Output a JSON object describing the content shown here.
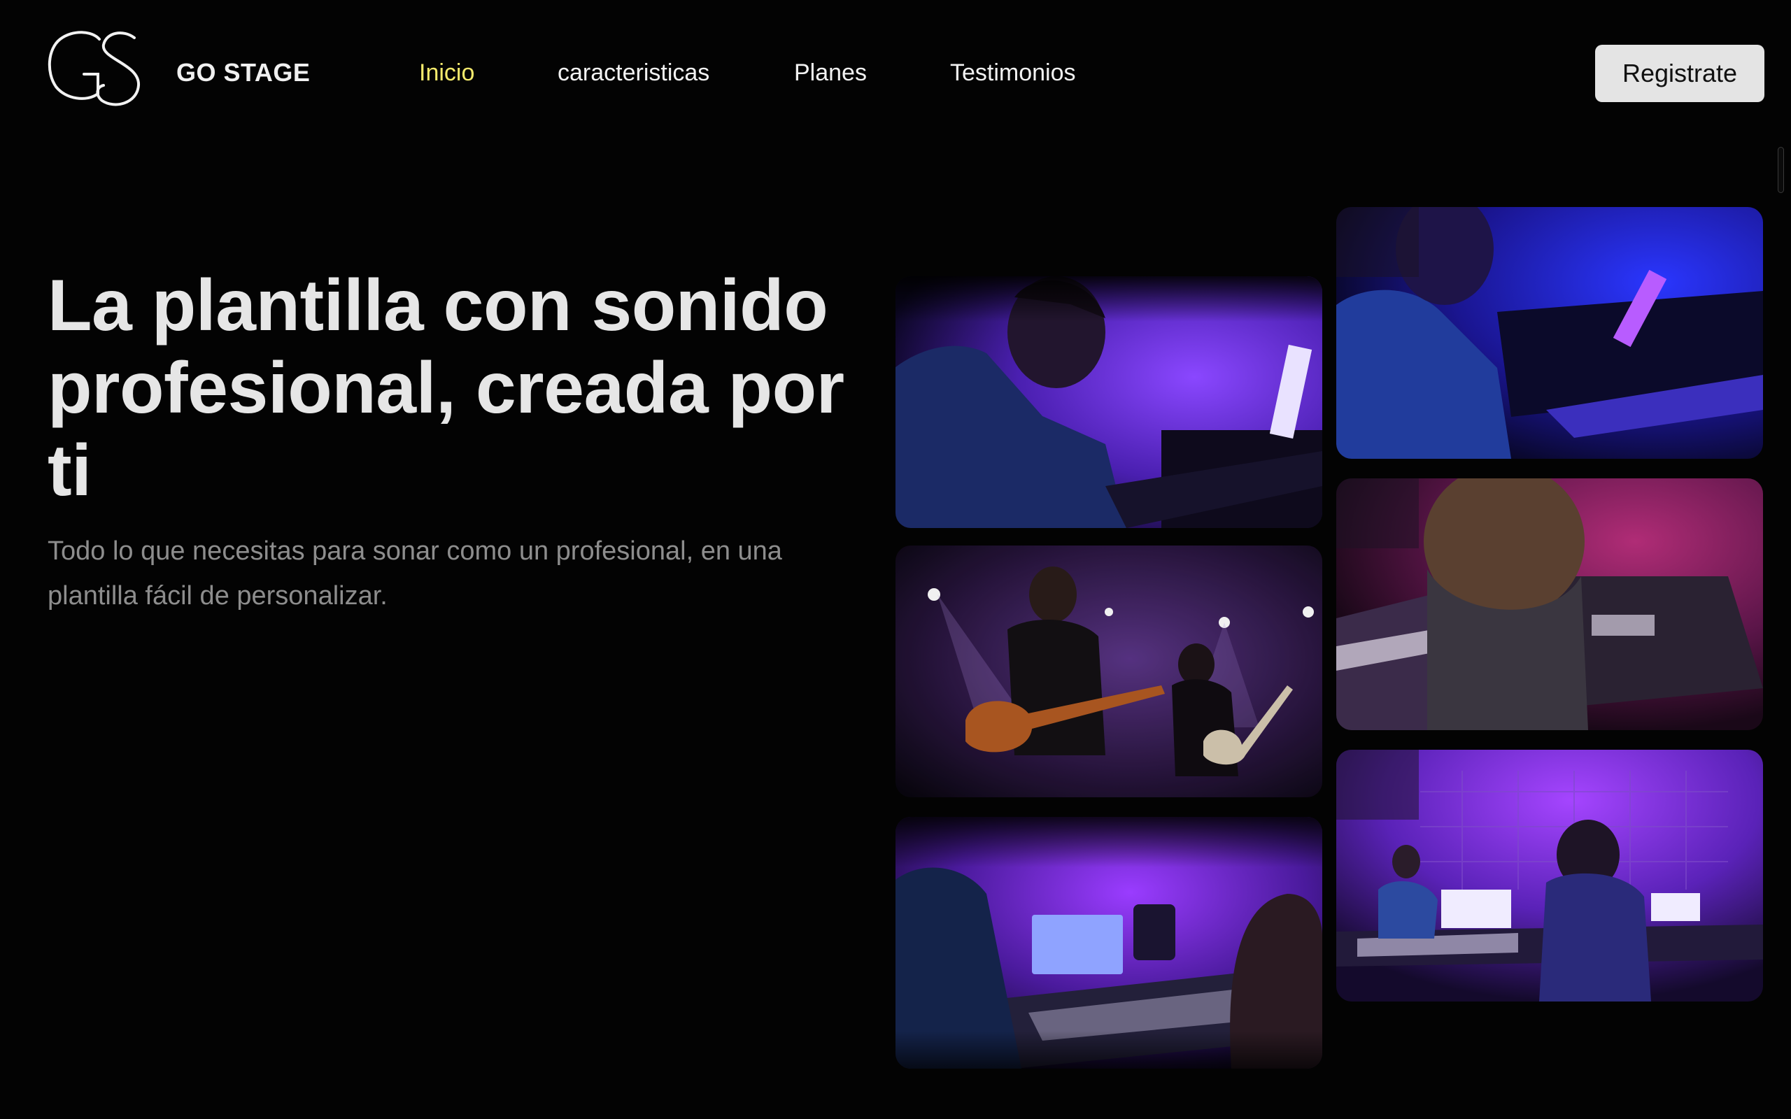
{
  "brand": {
    "logo_letters": "GS",
    "name": "GO STAGE"
  },
  "nav": {
    "items": [
      {
        "label": "Inicio",
        "active": true
      },
      {
        "label": "caracteristicas",
        "active": false
      },
      {
        "label": "Planes",
        "active": false
      },
      {
        "label": "Testimonios",
        "active": false
      }
    ]
  },
  "cta": {
    "register_label": "Registrate"
  },
  "hero": {
    "title": "La plantilla con sonido profesional, creada por ti",
    "subtitle": "Todo lo que necesitas para sonar como un profesional, en una plantilla fácil de personalizar."
  },
  "gallery": {
    "photos": [
      {
        "subject": "musician-at-keyboard-purple-light"
      },
      {
        "subject": "pianist-blue-light"
      },
      {
        "subject": "guitarists-on-stage"
      },
      {
        "subject": "synthesizer-over-shoulder"
      },
      {
        "subject": "producers-at-mixing-console"
      },
      {
        "subject": "recording-studio-session"
      }
    ]
  },
  "colors": {
    "background": "#030303",
    "active_nav": "#f4ea6c",
    "button_bg": "#e4e4e4",
    "title": "#e6e6e6",
    "subtitle": "#8d8d8d",
    "accent_purple": "#7b3cf0"
  }
}
